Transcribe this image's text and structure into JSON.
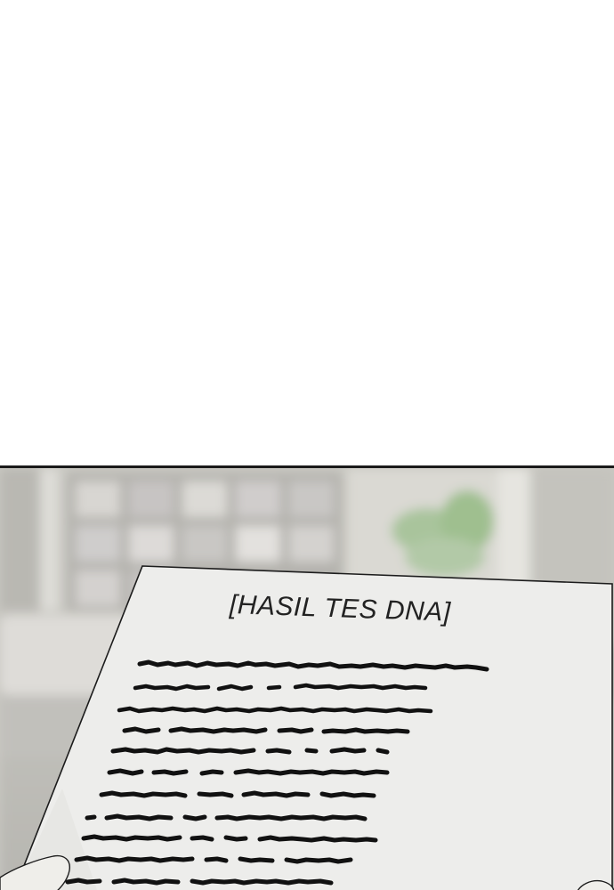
{
  "document": {
    "title": "[HASIL TES DNA]"
  },
  "colors": {
    "background": "#ffffff",
    "panel_border": "#1a1a1a",
    "paper": "#ededeb",
    "scribble": "#111111",
    "plant": "#9fbf8f"
  },
  "scene": {
    "background_icon": "blurred-living-room",
    "subject_icon": "paper-document"
  }
}
